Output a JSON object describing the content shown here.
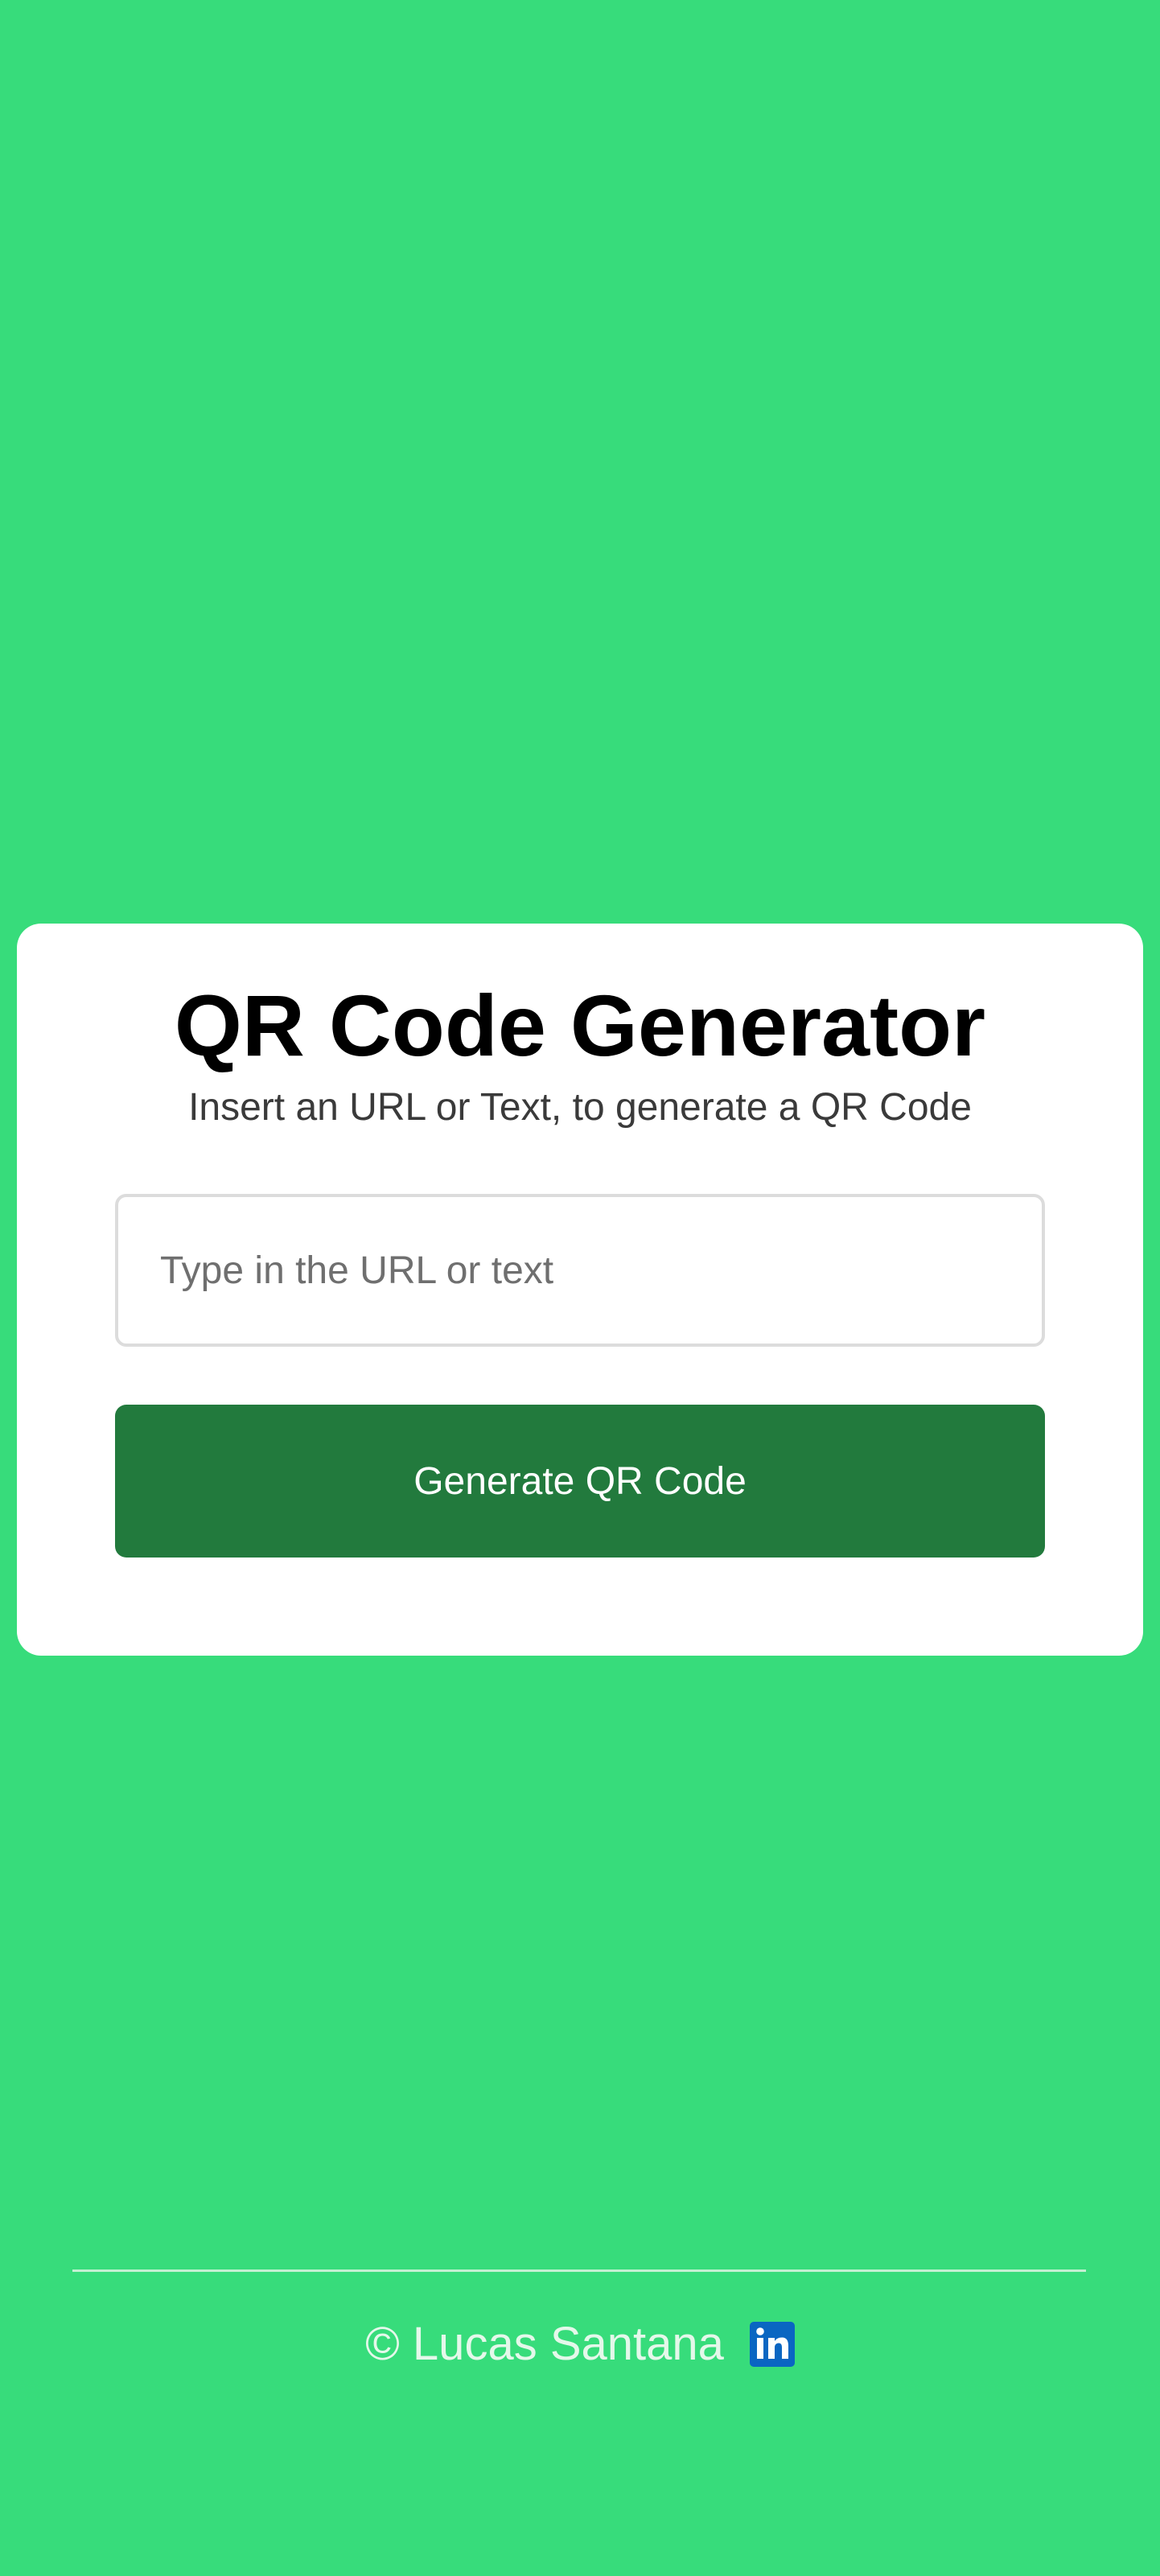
{
  "card": {
    "title": "QR Code Generator",
    "subtitle": "Insert an URL or Text, to generate a QR Code",
    "input": {
      "placeholder": "Type in the URL or text",
      "value": ""
    },
    "button_label": "Generate QR Code"
  },
  "footer": {
    "text": "© Lucas Santana",
    "icon": "linkedin-icon"
  },
  "colors": {
    "background": "#37dc7b",
    "card": "#ffffff",
    "button": "#227a3d",
    "linkedin": "#0a66c2"
  }
}
